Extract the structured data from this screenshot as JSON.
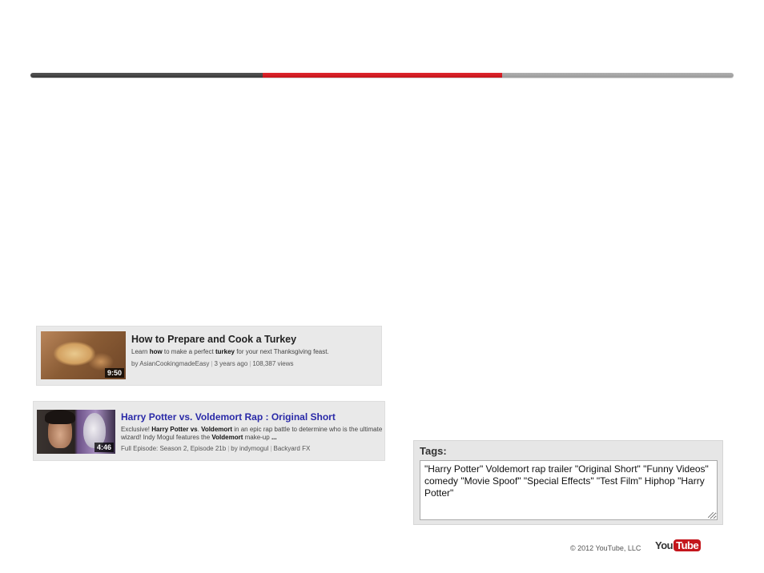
{
  "progress": {
    "segments": [
      {
        "name": "completed",
        "color": "#444444"
      },
      {
        "name": "current",
        "color": "#c4161c"
      },
      {
        "name": "remaining",
        "color": "#a3a3a3"
      }
    ]
  },
  "results": [
    {
      "title": "How to Prepare and Cook a Turkey",
      "duration": "9:50",
      "description_parts": [
        "Learn ",
        "how",
        " to make a perfect ",
        "turkey",
        " for your next Thanksgiving feast."
      ],
      "author": "by AsianCookingmadeEasy",
      "age": "3 years ago",
      "views": "108,387 views",
      "title_color": "#222222"
    },
    {
      "title": "Harry Potter vs. Voldemort Rap : Original Short",
      "duration": "4:46",
      "description_line1_parts": [
        "Exclusive! ",
        "Harry Potter",
        " ",
        "vs",
        ". ",
        "Voldemort",
        " in an epic rap battle to determine who is the ultimate"
      ],
      "description_line2_parts": [
        "wizard! Indy Mogul features the ",
        "Voldemort",
        " make-up ",
        "..."
      ],
      "episode": "Full Episode: Season 2, Episode 21b",
      "author": "by indymogul",
      "channel": "Backyard FX",
      "title_color": "#2a2aa8"
    }
  ],
  "tags": {
    "label": "Tags:",
    "value": "\"Harry Potter\" Voldemort rap trailer \"Original Short\" \"Funny Videos\" comedy \"Movie Spoof\" \"Special Effects\" \"Test Film\" Hiphop \"Harry Potter\""
  },
  "footer": {
    "copyright": "© 2012 YouTube, LLC",
    "logo_you": "You",
    "logo_tube": "Tube"
  }
}
